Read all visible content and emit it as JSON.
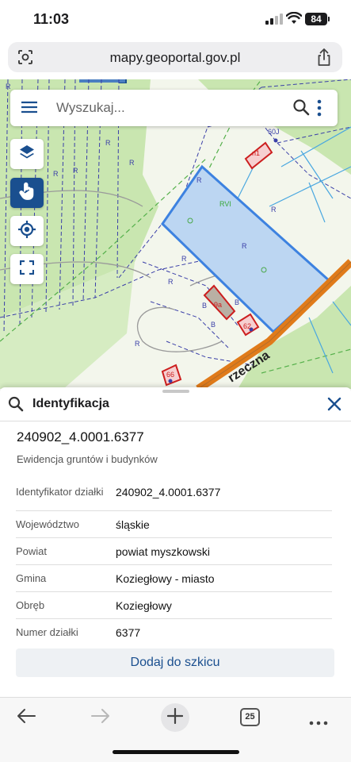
{
  "status": {
    "time": "11:03",
    "battery": "84"
  },
  "browser": {
    "url": "mapy.geoportal.gov.pl",
    "tabs_count": "25"
  },
  "search": {
    "placeholder": "Wyszukaj..."
  },
  "map": {
    "labels": {
      "rvi": "RVI",
      "r": "R",
      "b": "B",
      "n60j": "60J",
      "n1": "n1",
      "n62": "62",
      "n66": "66",
      "n9a": "9a",
      "street": "rzeczna"
    }
  },
  "panel": {
    "title": "Identyfikacja",
    "parcel_id": "240902_4.0001.6377",
    "subtitle": "Ewidencja gruntów i budynków",
    "rows": [
      {
        "key": "Identyfikator działki",
        "value": "240902_4.0001.6377"
      },
      {
        "key": "Województwo",
        "value": "śląskie"
      },
      {
        "key": "Powiat",
        "value": "powiat myszkowski"
      },
      {
        "key": "Gmina",
        "value": "Koziegłowy - miasto"
      },
      {
        "key": "Obręb",
        "value": "Koziegłowy"
      },
      {
        "key": "Numer działki",
        "value": "6377"
      }
    ],
    "add_button": "Dodaj do szkicu"
  },
  "colors": {
    "accent": "#1a4f8f",
    "parcel_fill": "#bcd6f2",
    "parcel_stroke": "#3d82e0",
    "greenery": "#c9e6b0",
    "road": "#e07b1a"
  },
  "icons": [
    "camera-search-icon",
    "share-icon",
    "menu-icon",
    "search-icon",
    "more-vert-icon",
    "layers-icon",
    "touch-icon",
    "locate-icon",
    "fullscreen-icon",
    "close-icon",
    "back-icon",
    "forward-icon",
    "plus-icon",
    "more-horiz-icon"
  ]
}
